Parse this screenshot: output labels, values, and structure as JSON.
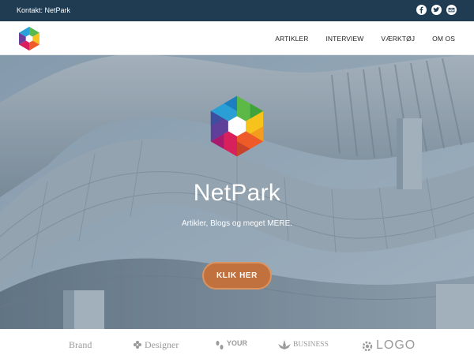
{
  "topbar": {
    "contact_text": "Kontakt: NetPark",
    "social_icons": [
      "facebook-icon",
      "twitter-icon",
      "email-icon"
    ]
  },
  "nav": {
    "logo_icon": "netpark-hexagon-logo",
    "items": [
      {
        "label": "ARTIKLER"
      },
      {
        "label": "INTERVIEW"
      },
      {
        "label": "VÆRKTØJ"
      },
      {
        "label": "OM OS"
      }
    ]
  },
  "hero": {
    "title": "NetPark",
    "tagline": "Artikler, Blogs og meget MERE.",
    "cta_label": "KLIK HER"
  },
  "clients": [
    {
      "text": "Brand"
    },
    {
      "text": "Designer"
    },
    {
      "text": "YOUR"
    },
    {
      "text": "BUSINESS"
    },
    {
      "text": "LOGO"
    }
  ],
  "colors": {
    "topbar_bg": "#1f3c52",
    "cta_bg": "#c0713e",
    "nav_bg": "#ffffff",
    "hero_overlay": "#40586e"
  }
}
